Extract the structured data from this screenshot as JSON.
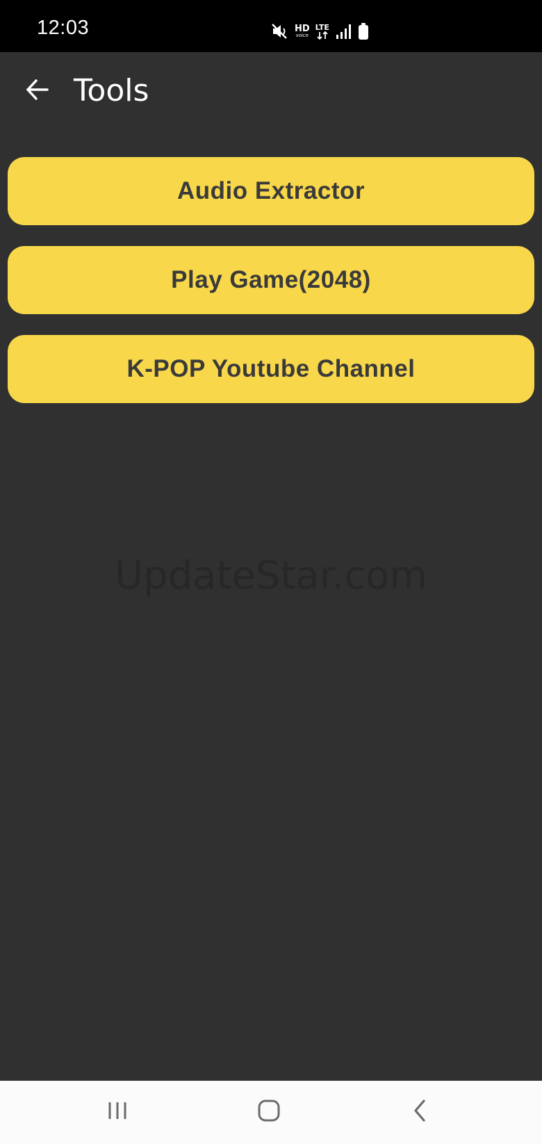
{
  "status_bar": {
    "time": "12:03",
    "icons": [
      "mute-icon",
      "hd-voice-icon",
      "lte-icon",
      "signal-icon",
      "battery-icon"
    ],
    "hd_label": "HD",
    "voice_label": "voice",
    "lte_label": "LTE"
  },
  "app_bar": {
    "title": "Tools",
    "back_icon": "arrow-left-icon"
  },
  "tools": [
    {
      "label": "Audio Extractor"
    },
    {
      "label": "Play Game(2048)"
    },
    {
      "label": "K-POP Youtube Channel"
    }
  ],
  "watermark": "UpdateStar.com",
  "nav_bar": {
    "icons": [
      "recent-apps-icon",
      "home-icon",
      "back-icon"
    ]
  },
  "colors": {
    "background": "#303030",
    "button": "#f8d84a",
    "button_text": "#3a3a3a",
    "status_bar": "#000000",
    "nav_bar": "#fbfbfb"
  }
}
